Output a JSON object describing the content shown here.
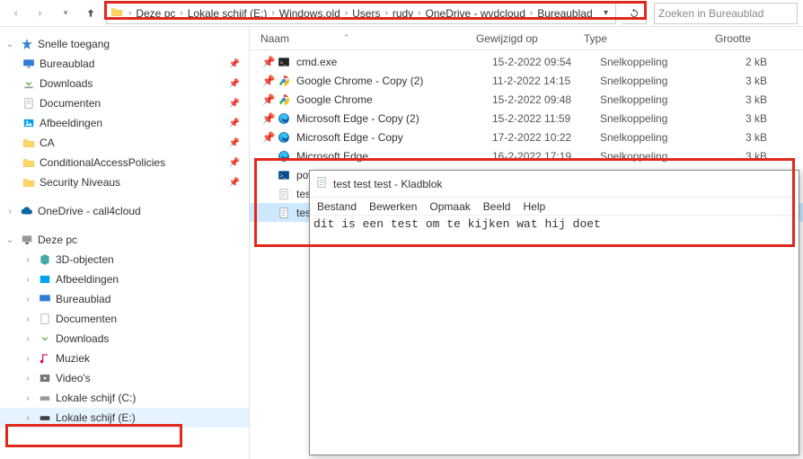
{
  "toolbar": {
    "breadcrumb": [
      "Deze pc",
      "Lokale schijf (E:)",
      "Windows.old",
      "Users",
      "rudy",
      "OneDrive - wvdcloud",
      "Bureaublad"
    ],
    "search_placeholder": "Zoeken in Bureaublad"
  },
  "tree": {
    "quick_access_label": "Snelle toegang",
    "quick_items": [
      {
        "label": "Bureaublad",
        "icon": "desktop",
        "pinned": true
      },
      {
        "label": "Downloads",
        "icon": "downloads",
        "pinned": true
      },
      {
        "label": "Documenten",
        "icon": "documents",
        "pinned": true
      },
      {
        "label": "Afbeeldingen",
        "icon": "pictures",
        "pinned": true
      },
      {
        "label": "CA",
        "icon": "folder",
        "pinned": true
      },
      {
        "label": "ConditionalAccessPolicies",
        "icon": "folder",
        "pinned": true
      },
      {
        "label": "Security Niveaus",
        "icon": "folder",
        "pinned": true
      }
    ],
    "onedrive_label": "OneDrive - call4cloud",
    "this_pc_label": "Deze pc",
    "pc_items": [
      {
        "label": "3D-objecten",
        "icon": "3d"
      },
      {
        "label": "Afbeeldingen",
        "icon": "pictures"
      },
      {
        "label": "Bureaublad",
        "icon": "desktop"
      },
      {
        "label": "Documenten",
        "icon": "documents"
      },
      {
        "label": "Downloads",
        "icon": "downloads"
      },
      {
        "label": "Muziek",
        "icon": "music"
      },
      {
        "label": "Video's",
        "icon": "videos"
      },
      {
        "label": "Lokale schijf (C:)",
        "icon": "drive"
      },
      {
        "label": "Lokale schijf (E:)",
        "icon": "drive",
        "selected": true
      }
    ]
  },
  "columns": {
    "name": "Naam",
    "date": "Gewijzigd op",
    "type": "Type",
    "size": "Grootte"
  },
  "files": [
    {
      "icon": "cmd",
      "pinned": true,
      "name": "cmd.exe",
      "date": "15-2-2022 09:54",
      "type": "Snelkoppeling",
      "size": "2 kB"
    },
    {
      "icon": "chrome",
      "pinned": true,
      "name": "Google Chrome - Copy (2)",
      "date": "11-2-2022 14:15",
      "type": "Snelkoppeling",
      "size": "3 kB"
    },
    {
      "icon": "chrome",
      "pinned": true,
      "name": "Google Chrome",
      "date": "15-2-2022 09:48",
      "type": "Snelkoppeling",
      "size": "3 kB"
    },
    {
      "icon": "edge",
      "pinned": true,
      "name": "Microsoft Edge - Copy (2)",
      "date": "15-2-2022 11:59",
      "type": "Snelkoppeling",
      "size": "3 kB"
    },
    {
      "icon": "edge",
      "pinned": true,
      "name": "Microsoft Edge - Copy",
      "date": "17-2-2022 10:22",
      "type": "Snelkoppeling",
      "size": "3 kB"
    },
    {
      "icon": "edge",
      "pinned": false,
      "name": "Microsoft Edge",
      "date": "16-2-2022 17:19",
      "type": "Snelkoppeling",
      "size": "3 kB"
    },
    {
      "icon": "ps",
      "pinned": false,
      "name": "power",
      "date": "",
      "type": "",
      "size": ""
    },
    {
      "icon": "text",
      "pinned": false,
      "name": "test te",
      "date": "",
      "type": "",
      "size": ""
    },
    {
      "icon": "text",
      "pinned": false,
      "name": "test te",
      "date": "",
      "type": "",
      "size": "",
      "selected": true
    }
  ],
  "notepad": {
    "title": "test test test - Kladblok",
    "menus": [
      "Bestand",
      "Bewerken",
      "Opmaak",
      "Beeld",
      "Help"
    ],
    "content": "dit is een test om te kijken wat hij doet"
  }
}
